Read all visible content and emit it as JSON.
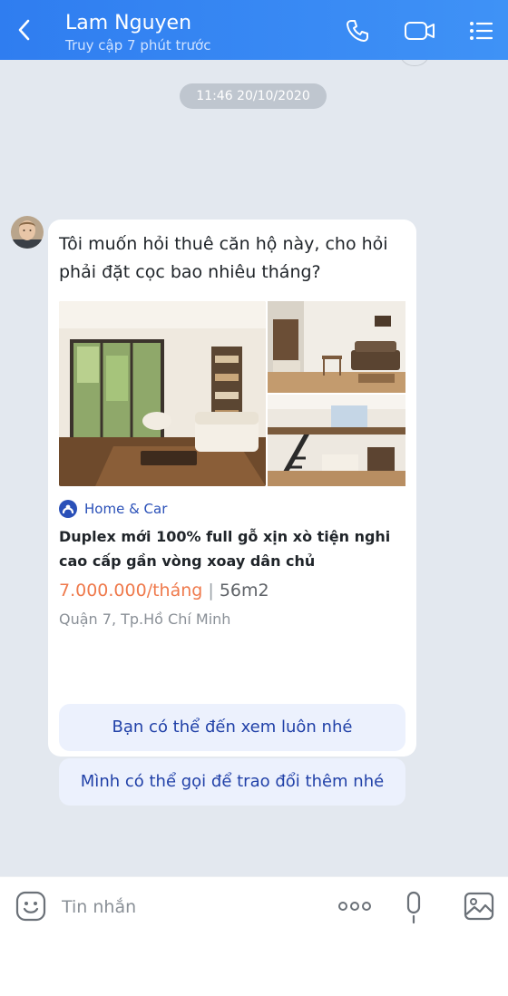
{
  "header": {
    "contact_name": "Lam Nguyen",
    "status": "Truy cập 7 phút trước",
    "icons": [
      "chevron-left-icon",
      "phone-icon",
      "video-call-icon",
      "list-menu-icon"
    ],
    "bg_color": "#3a8af4"
  },
  "chat": {
    "timestamp": "11:46 20/10/2020",
    "message": {
      "text": "Tôi muốn hỏi thuê căn hộ này, cho hỏi phải đặt cọc bao nhiêu tháng?",
      "listing": {
        "source": "Home & Car",
        "title": "Duplex mới 100% full gỗ xịn xò tiện nghi cao cấp gần vòng xoay dân chủ",
        "price": "7.000.000/tháng",
        "separator": "|",
        "area": "56m2",
        "location": "Quận 7, Tp.Hồ Chí Minh"
      }
    },
    "quick_replies": [
      "Bạn có thể đến xem luôn nhé",
      "Mình có thể gọi để trao đổi thêm nhé"
    ],
    "bg_color": "#e3e8ef"
  },
  "input_bar": {
    "placeholder": "Tin nhắn",
    "icons": [
      "emoji-icon",
      "more-icon",
      "microphone-icon",
      "gallery-icon"
    ]
  },
  "colors": {
    "accent": "#2141a8",
    "price": "#ef7a4c",
    "quick_reply_bg": "#ecf1fd"
  }
}
